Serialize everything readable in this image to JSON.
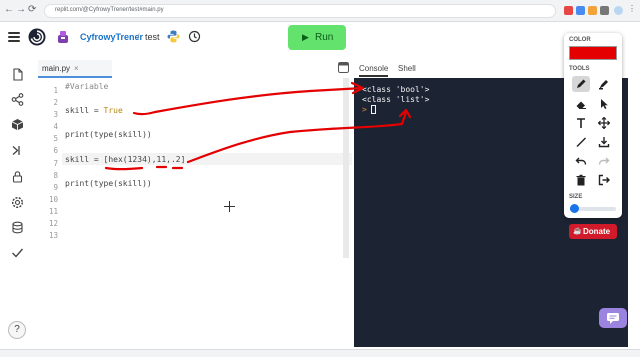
{
  "browser": {
    "url": "replit.com/@CyfrowyTrener/test#main.py",
    "back_glyph": "←",
    "forward_glyph": "→",
    "reload_glyph": "⟳"
  },
  "header": {
    "username": "CyfrowyTrener",
    "separator": "/",
    "repl_name": "test",
    "run_icon": "play-icon",
    "run_label": "Run"
  },
  "sidebar": {
    "icons": [
      "files-icon",
      "share-icon",
      "packages-icon",
      "shell-icon",
      "secrets-icon",
      "settings-icon",
      "database-icon",
      "checkmark-icon"
    ],
    "help": "?"
  },
  "editor": {
    "tab_label": "main.py",
    "tab_close": "×",
    "line_numbers": [
      "1",
      "2",
      "3",
      "4",
      "5",
      "6",
      "7",
      "8",
      "9",
      "10",
      "11",
      "12",
      "13"
    ],
    "lines": {
      "l1": "#Variable",
      "l3a": "skill = ",
      "l3b": "True",
      "l5": "print(type(skill))",
      "l7": "skill = [hex(1234),11,.2]",
      "l9": "print(type(skill))"
    }
  },
  "console": {
    "tabs": [
      "Console",
      "Shell"
    ],
    "output": [
      "<class 'bool'>",
      "<class 'list'>"
    ],
    "prompt": ">"
  },
  "tool_panel": {
    "color_label": "COLOR",
    "selected_color": "#e40000",
    "tools_label": "TOOLS",
    "tools": [
      "pencil-icon",
      "marker-icon",
      "eraser-icon",
      "pointer-icon",
      "text-icon",
      "move-icon",
      "line-icon",
      "download-icon",
      "undo-icon",
      "redo-icon",
      "trash-icon",
      "exit-icon"
    ],
    "size_label": "SIZE",
    "size_level": 0.1
  },
  "donate": {
    "label": "Donate"
  },
  "colors": {
    "accent": "#e40000",
    "run_button": "#63e36d",
    "console_bg": "#1c2333",
    "donate": "#d11a2a",
    "chat": "#9b83e0"
  }
}
